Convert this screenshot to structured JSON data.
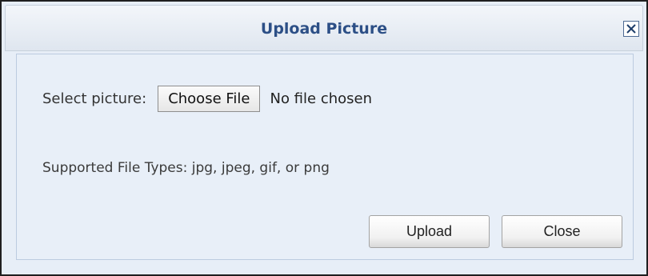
{
  "dialog": {
    "title": "Upload Picture",
    "close_icon": "close-x-icon"
  },
  "form": {
    "select_label": "Select picture:",
    "choose_file_label": "Choose File",
    "file_status": "No file chosen",
    "supported_types": "Supported File Types: jpg, jpeg, gif, or png"
  },
  "buttons": {
    "upload_label": "Upload",
    "close_label": "Close"
  },
  "colors": {
    "title": "#2c4f86",
    "background": "#e7eef7"
  }
}
